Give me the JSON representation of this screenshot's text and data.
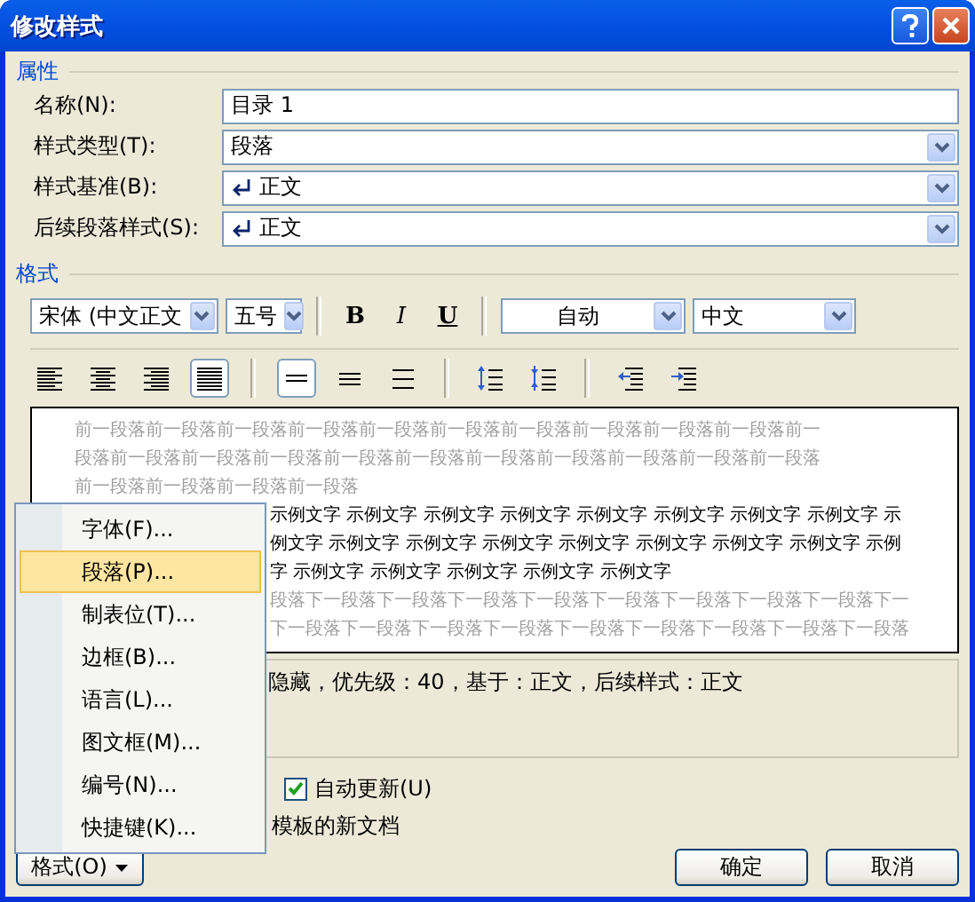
{
  "window": {
    "title": "修改样式"
  },
  "properties_section": {
    "title": "属性"
  },
  "properties": [
    {
      "label": "名称(N):",
      "value": "目录 1",
      "kind": "text",
      "paragraph_mark": false
    },
    {
      "label": "样式类型(T):",
      "value": "段落",
      "kind": "dropdown",
      "paragraph_mark": false
    },
    {
      "label": "样式基准(B):",
      "value": "正文",
      "kind": "dropdown",
      "paragraph_mark": true
    },
    {
      "label": "后续段落样式(S):",
      "value": "正文",
      "kind": "dropdown",
      "paragraph_mark": true
    }
  ],
  "format_section": {
    "title": "格式"
  },
  "font_toolbar": {
    "font": "宋体 (中文正文",
    "size": "五号",
    "styles": [
      {
        "text": "B",
        "kind": "bold",
        "selected": false
      },
      {
        "text": "I",
        "kind": "italic",
        "selected": false
      },
      {
        "text": "U",
        "kind": "underline",
        "selected": false
      }
    ],
    "font_color": "自动",
    "language": "中文"
  },
  "paragraph_toolbar": [
    {
      "kind": "align-left",
      "selected": false
    },
    {
      "kind": "align-center",
      "selected": false
    },
    {
      "kind": "align-right",
      "selected": false
    },
    {
      "kind": "justify",
      "selected": true
    },
    {
      "kind": "single-spacing",
      "selected": true
    },
    {
      "kind": "one-half-spacing",
      "selected": false
    },
    {
      "kind": "double-spacing",
      "selected": false
    },
    {
      "kind": "increase-spacing",
      "selected": false
    },
    {
      "kind": "decrease-spacing",
      "selected": false
    },
    {
      "kind": "decrease-indent",
      "selected": false
    },
    {
      "kind": "increase-indent",
      "selected": false
    }
  ],
  "preview": {
    "previous_paragraph": [
      "前一段落前一段落前一段落前一段落前一段落前一段落前一段落前一段落前一段落前一段落前一",
      "段落前一段落前一段落前一段落前一段落前一段落前一段落前一段落前一段落前一段落前一段落",
      "前一段落前一段落前一段落前一段落"
    ],
    "sample_text": [
      "示例文字 示例文字 示例文字 示例文字 示例文字 示例文字 示例文字 示例文字 示",
      "例文字 示例文字 示例文字 示例文字 示例文字 示例文字 示例文字 示例文字 示例",
      "字 示例文字 示例文字 示例文字 示例文字 示例文字"
    ],
    "next_paragraph": [
      "段落下一段落下一段落下一段落下一段落下一段落下一段落下一段落下一段落下一",
      "下一段落下一段落下一段落下一段落下一段落下一段落下一段落下一段落下一段落"
    ]
  },
  "description": "隐藏，优先级：40，基于：正文，后续样式：正文",
  "auto_update": {
    "label": "自动更新(U)",
    "checked": true
  },
  "template_option": {
    "label": "模板的新文档"
  },
  "format_button": {
    "label": "格式(O)"
  },
  "buttons": [
    "确定",
    "取消"
  ],
  "format_menu": [
    {
      "label": "字体(F)...",
      "selected": false
    },
    {
      "label": "段落(P)...",
      "selected": true
    },
    {
      "label": "制表位(T)...",
      "selected": false
    },
    {
      "label": "边框(B)...",
      "selected": false
    },
    {
      "label": "语言(L)...",
      "selected": false
    },
    {
      "label": "图文框(M)...",
      "selected": false
    },
    {
      "label": "编号(N)...",
      "selected": false
    },
    {
      "label": "快捷键(K)...",
      "selected": false
    }
  ]
}
